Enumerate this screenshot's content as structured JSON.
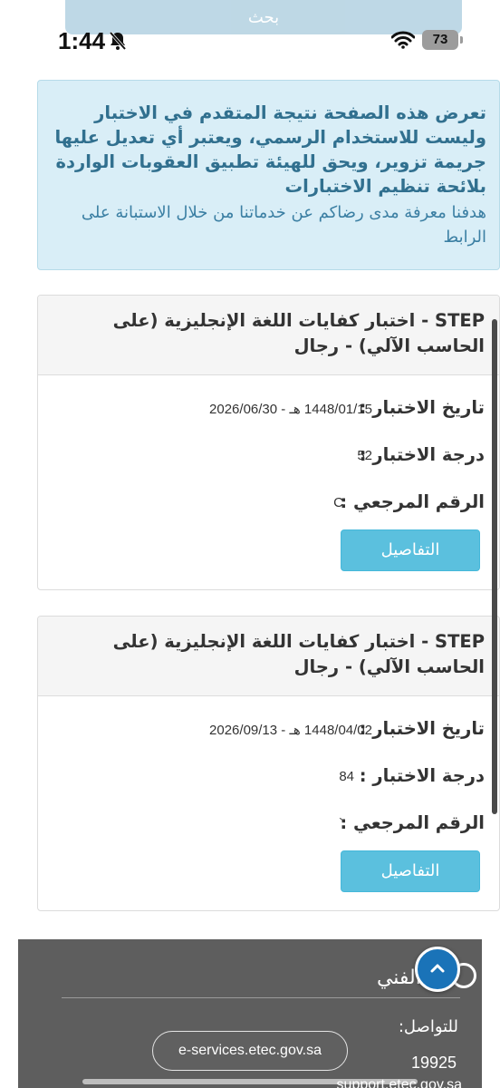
{
  "status_bar": {
    "time": "1:44",
    "battery": "73"
  },
  "search_peek_label": "بحث",
  "notice": {
    "bold_text": "تعرض هذه الصفحة نتيجة المتقدم في الاختبار وليست للاستخدام الرسمي، ويعتبر أي تعديل عليها جريمة تزوير، ويحق للهيئة تطبيق العقوبات الواردة بلائحة تنظيم الاختبارات",
    "normal_text": "هدفنا معرفة مدى رضاكم عن خدماتنا من خلال الاستبانة على الرابط"
  },
  "labels": {
    "test_date": "تاريخ الاختبار :",
    "test_score": "درجة الاختبار :",
    "reference_number": "الرقم المرجعي :",
    "details_button": "التفاصيل"
  },
  "results": [
    {
      "title": "STEP - اختبار كفايات اللغة الإنجليزية (على الحاسب الآلي) - رجال",
      "date": "1448/01/15 هـ - 2026/06/30",
      "score": "52",
      "reference": "C"
    },
    {
      "title": "STEP - اختبار كفايات اللغة الإنجليزية (على الحاسب الآلي) - رجال",
      "date": "1448/04/02 هـ - 2026/09/13",
      "score": "84",
      "reference": "`"
    }
  ],
  "footer": {
    "title": "الدعم الفني",
    "contact_label": "للتواصل:",
    "phone": "19925",
    "email": "support.etec.gov.sa"
  },
  "url_bar": "e-services.etec.gov.sa",
  "colors": {
    "notice_bg": "#d9eef7",
    "notice_text": "#31708f",
    "button": "#5bc0de",
    "footer": "#5e5e5e",
    "back_to_top": "#1a73b8"
  }
}
